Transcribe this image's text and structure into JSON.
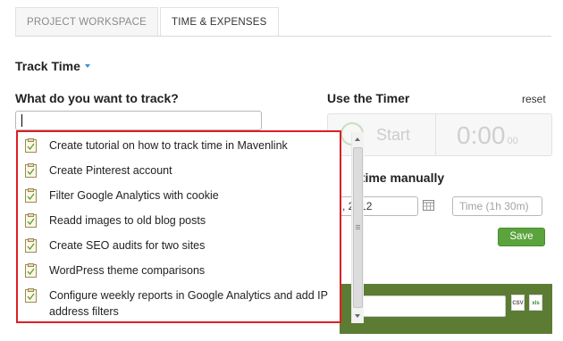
{
  "tabs": [
    {
      "label": "PROJECT WORKSPACE",
      "active": false
    },
    {
      "label": "TIME & EXPENSES",
      "active": true
    }
  ],
  "track_time": {
    "header": "Track Time",
    "question": "What do you want to track?",
    "input_value": ""
  },
  "timer": {
    "title": "Use the Timer",
    "reset": "reset",
    "start": "Start",
    "display": "0:00",
    "display_sub": "00"
  },
  "manual": {
    "title": "l time manually",
    "date_value": ", 2012",
    "time_placeholder": "Time (1h 30m)",
    "save": "Save"
  },
  "dropdown": {
    "items": [
      "Create tutorial on how to track time in Mavenlink",
      "Create Pinterest account",
      "Filter Google Analytics with cookie",
      "Readd images to old blog posts",
      "Create SEO audits for two sites",
      "WordPress theme comparisons",
      "Configure weekly reports in Google Analytics and add IP address filters"
    ]
  },
  "file_icons": {
    "csv": "CSV",
    "xls": "xls"
  },
  "colors": {
    "accent_blue": "#3b8fd0",
    "highlight_red": "#dd1f26",
    "save_green": "#5ba33d",
    "bar_green": "#5c7c33"
  }
}
